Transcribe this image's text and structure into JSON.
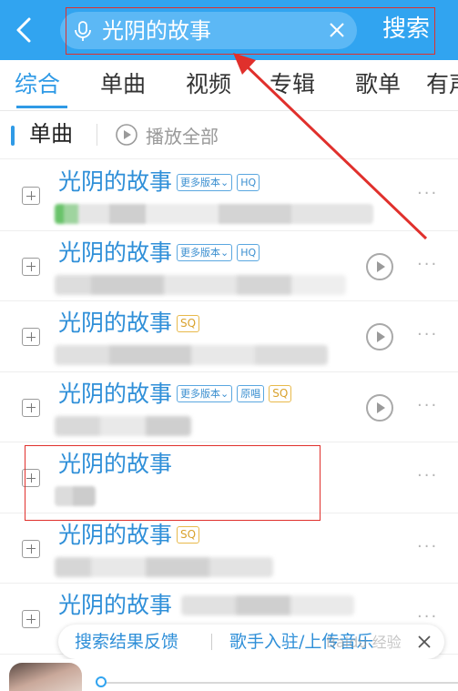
{
  "header": {
    "query": "光阴的故事",
    "search_label": "搜索"
  },
  "tabs": [
    {
      "label": "综合",
      "active": true
    },
    {
      "label": "单曲"
    },
    {
      "label": "视频"
    },
    {
      "label": "专辑"
    },
    {
      "label": "歌单"
    },
    {
      "label": "有声"
    }
  ],
  "section": {
    "title": "单曲",
    "play_all_label": "播放全部"
  },
  "songs": [
    {
      "title": "光阴的故事",
      "tags": [
        "更多版本",
        "HQ"
      ]
    },
    {
      "title": "光阴的故事",
      "tags": [
        "更多版本",
        "HQ"
      ]
    },
    {
      "title": "光阴的故事",
      "tags": [
        "SQ"
      ]
    },
    {
      "title": "光阴的故事",
      "tags": [
        "更多版本",
        "原唱",
        "SQ"
      ]
    },
    {
      "title": "光阴的故事",
      "tags": []
    },
    {
      "title": "光阴的故事",
      "tags": [
        "SQ"
      ]
    },
    {
      "title": "光阴的故事",
      "tags": []
    }
  ],
  "feedback": {
    "report_label": "搜索结果反馈",
    "upload_label": "歌手入驻/上传音乐"
  },
  "watermark": "Baidu 经验",
  "colors": {
    "accent": "#31a4f0",
    "link": "#2f8fd8",
    "annotation": "#e0302c"
  }
}
